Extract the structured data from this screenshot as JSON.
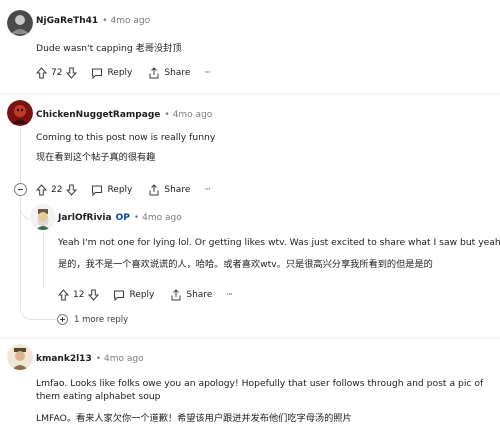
{
  "comments": [
    {
      "username": "NjGaReTh41",
      "time": "4mo ago",
      "lines": [
        "Dude wasn't capping  老哥没封顶"
      ],
      "votes": "72",
      "reply_label": "Reply",
      "share_label": "Share",
      "more_label": "···"
    },
    {
      "username": "ChickenNuggetRampage",
      "time": "4mo ago",
      "lines": [
        "Coming to this post now is really funny",
        "现在看到这个帖子真的很有趣"
      ],
      "votes": "22",
      "reply_label": "Reply",
      "share_label": "Share",
      "more_label": "···"
    },
    {
      "username": "JarlOfRivia",
      "op_label": "OP",
      "time": "4mo ago",
      "lines": [
        "Yeah I'm not one for lying lol. Or getting likes wtv. Was just excited to share what I saw but yeah",
        "是的，我不是一个喜欢说谎的人，哈哈。或者喜欢wtv。只是很高兴分享我所看到的但是是的"
      ],
      "votes": "12",
      "reply_label": "Reply",
      "share_label": "Share",
      "more_label": "···",
      "more_replies": "1 more reply"
    },
    {
      "username": "kmank2l13",
      "time": "4mo ago",
      "lines": [
        "Lmfao. Looks like folks owe you an apology! Hopefully that user follows through and post a pic of them eating alphabet soup",
        "LMFAO。看来人家欠你一个道歉！希望该用户跟进并发布他们吃字母汤的照片"
      ]
    }
  ],
  "separator": "•",
  "colors": {
    "accent_op": "#0045ac",
    "text_primary": "#1c1c1c",
    "text_muted": "#7c7c7c",
    "thread_line": "#e2e4e7"
  }
}
